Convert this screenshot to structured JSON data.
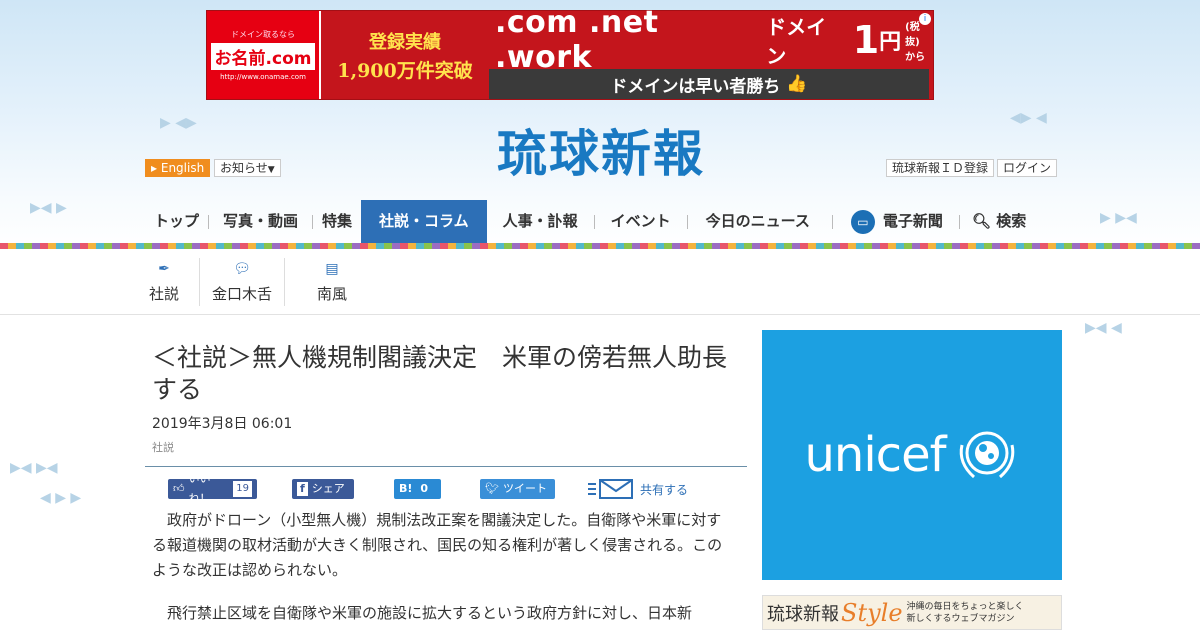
{
  "ad": {
    "left_small": "ドメイン取るなら",
    "left_brand": "お名前.com",
    "left_url": "http://www.onamae.com",
    "mid_line1": "登録実績",
    "mid_line2": "1,900万件突破",
    "tlds": ".com .net .work",
    "domain_word": "ドメイン",
    "price": "1",
    "yen": "円",
    "tax": "(税抜)",
    "kara": "から",
    "slogan": "ドメインは早い者勝ち",
    "info": "i"
  },
  "header": {
    "logo": "琉球新報",
    "english": "English",
    "notice": "お知らせ",
    "register": "琉球新報ＩＤ登録",
    "login": "ログイン"
  },
  "nav": {
    "items": [
      "トップ",
      "写真・動画",
      "特集",
      "社説・コラム",
      "人事・訃報",
      "イベント",
      "今日のニュース",
      "電子新聞",
      "検索"
    ]
  },
  "subnav": {
    "items": [
      "社説",
      "金口木舌",
      "南風"
    ]
  },
  "article": {
    "title": "＜社説＞無人機規制閣議決定　米軍の傍若無人助長する",
    "date": "2019年3月8日 06:01",
    "category": "社説",
    "like_label": "いいね！",
    "like_count": "19",
    "share_label": "シェア",
    "hatena_label": "B!",
    "hatena_count": "0",
    "tweet_label": "ツイート",
    "kyoyu_label": "共有する",
    "paragraphs": [
      "政府がドローン（小型無人機）規制法改正案を閣議決定した。自衛隊や米軍に対する報道機関の取材活動が大きく制限され、国民の知る権利が著しく侵害される。このような改正は認められない。",
      "飛行禁止区域を自衛隊や米軍の施設に拡大するという政府方針に対し、日本新"
    ]
  },
  "sidebar": {
    "unicef": "unicef",
    "style_name": "琉球新報",
    "style_word": "Style",
    "style_desc_1": "沖縄の毎日をちょっと楽しく",
    "style_desc_2": "新しくするウェブマガジン"
  },
  "colors": {
    "accent": "#2d6fb6",
    "logo": "#1979c2",
    "ad_red": "#c4151c",
    "unicef": "#1ca0e1",
    "facebook": "#3b5998"
  }
}
